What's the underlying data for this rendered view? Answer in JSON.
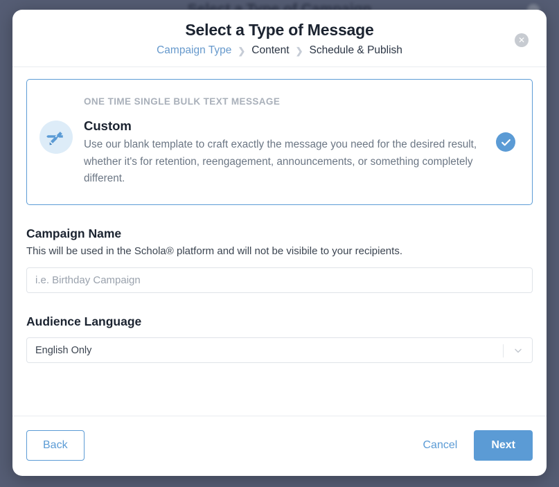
{
  "backdrop": {
    "ghost_title": "Select a Type of Campaign",
    "overlay_color": "#555d74"
  },
  "modal": {
    "title": "Select a Type of Message",
    "close_icon": "close-icon",
    "close_glyph": "✕",
    "breadcrumb": [
      {
        "label": "Campaign Type",
        "active": true
      },
      {
        "label": "Content",
        "active": false
      },
      {
        "label": "Schedule & Publish",
        "active": false
      }
    ],
    "breadcrumb_separator": "❯"
  },
  "option_card": {
    "kicker": "ONE TIME SINGLE BULK TEXT MESSAGE",
    "title": "Custom",
    "description": "Use our blank template to craft exactly the message you need for the desired result, whether it's for retention, reengagement, announcements, or something completely different.",
    "icon": "pencil-ruler-icon",
    "selected": true,
    "check_icon": "check-circle-icon",
    "border_color": "#5b9bd5",
    "icon_bg_color": "#ddecf8",
    "icon_color": "#5b9bd5"
  },
  "fields": {
    "campaign_name": {
      "label": "Campaign Name",
      "help": "This will be used in the Schola® platform and will not be visibile to your recipients.",
      "placeholder": "i.e. Birthday Campaign",
      "value": ""
    },
    "audience_language": {
      "label": "Audience Language",
      "selected": "English Only",
      "chevron_icon": "chevron-down-icon"
    }
  },
  "footer": {
    "back_label": "Back",
    "cancel_label": "Cancel",
    "next_label": "Next",
    "primary_color": "#5b9bd5"
  }
}
